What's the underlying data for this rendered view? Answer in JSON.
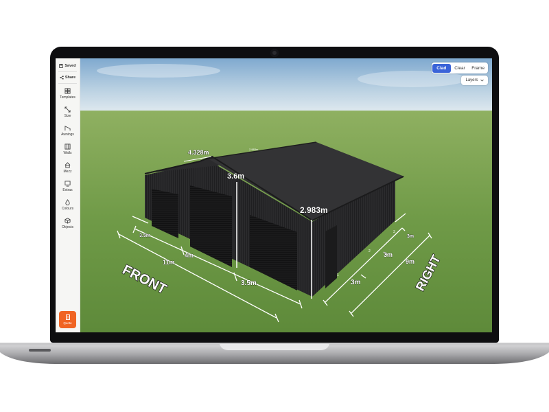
{
  "sidebar": {
    "saved_label": "Saved",
    "share_label": "Share",
    "items": [
      {
        "label": "Templates",
        "icon": "grid-icon"
      },
      {
        "label": "Size",
        "icon": "resize-icon"
      },
      {
        "label": "Awnings",
        "icon": "awning-icon"
      },
      {
        "label": "Walls",
        "icon": "walls-icon"
      },
      {
        "label": "Mezz",
        "icon": "house-icon"
      },
      {
        "label": "Extras",
        "icon": "extras-icon"
      },
      {
        "label": "Colours",
        "icon": "droplet-icon"
      },
      {
        "label": "Objects",
        "icon": "cube-icon"
      }
    ],
    "quote_label": "Quote",
    "quote_color": "#f06423"
  },
  "view_toggle": {
    "options": [
      "Clad",
      "Clear",
      "Frame"
    ],
    "active": "Clad",
    "active_color": "#3a63d8"
  },
  "layers_label": "Layers",
  "scene": {
    "roof_width_label": "4.328m",
    "ridge_label": "2.983m",
    "left_height_label": "3.6m",
    "right_height_label": "2.983m",
    "front_label": "FRONT",
    "right_label": "RIGHT",
    "front_total": "11m",
    "front_bays": [
      "3.5m",
      "4m",
      "3.5m"
    ],
    "side_total": "9m",
    "side_bays": [
      "3m",
      "3m",
      "3m"
    ],
    "bay_numbers": [
      "1",
      "2",
      "3"
    ],
    "shed_color": "#2b2b2d"
  }
}
